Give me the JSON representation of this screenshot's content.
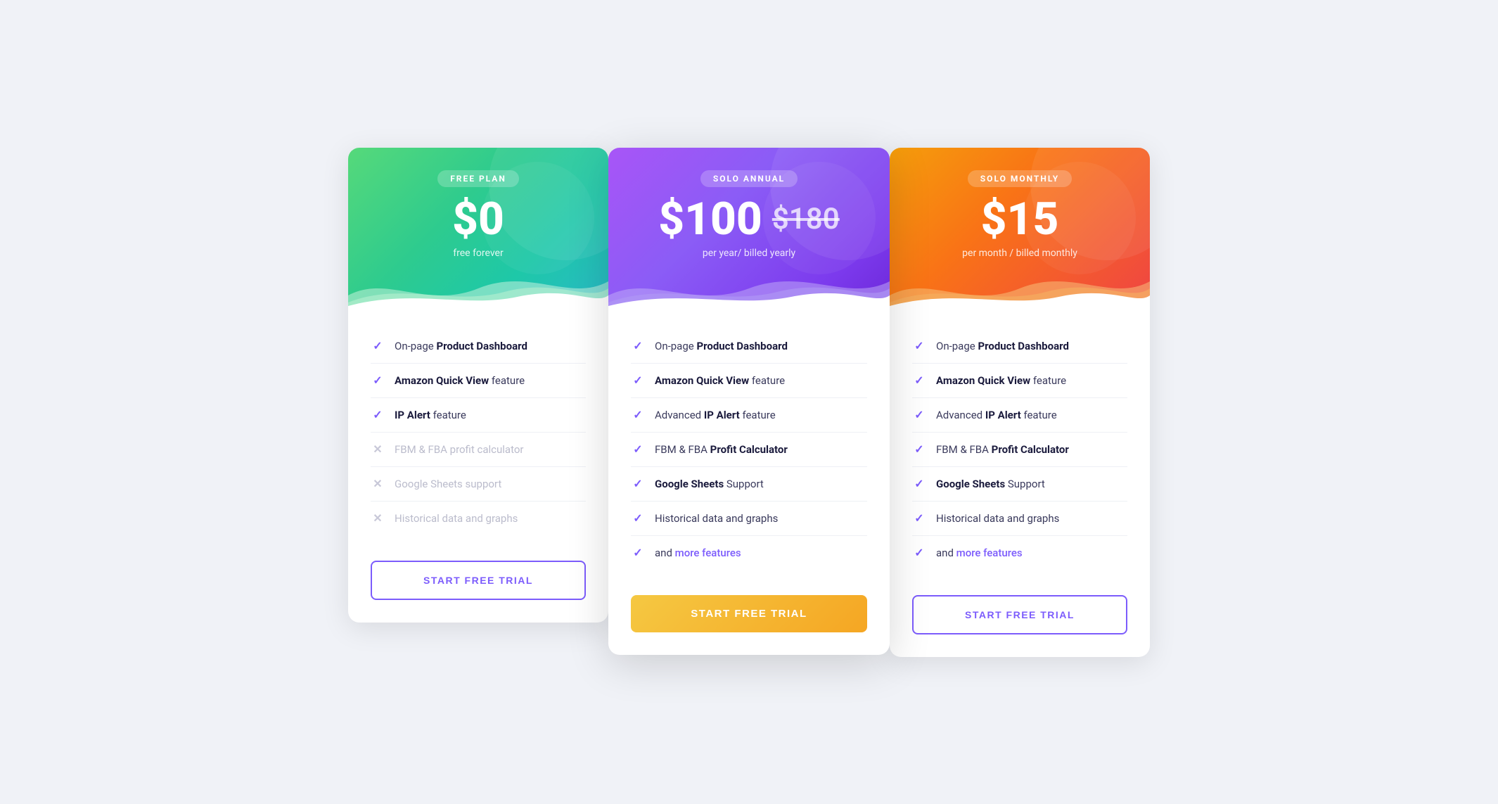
{
  "plans": [
    {
      "id": "free",
      "badge": "FREE PLAN",
      "price": "$0",
      "originalPrice": null,
      "sub": "free forever",
      "headerClass": "free",
      "featured": false,
      "btnClass": "btn-outline",
      "btnLabel": "START FREE TRIAL",
      "features": [
        {
          "enabled": true,
          "text": "On-page ",
          "bold": "Product Dashboard",
          "after": ""
        },
        {
          "enabled": true,
          "text": "",
          "bold": "Amazon Quick View",
          "after": " feature"
        },
        {
          "enabled": true,
          "text": "",
          "bold": "IP Alert",
          "after": " feature"
        },
        {
          "enabled": false,
          "text": "FBM & FBA profit calculator",
          "bold": "",
          "after": ""
        },
        {
          "enabled": false,
          "text": "Google Sheets support",
          "bold": "",
          "after": ""
        },
        {
          "enabled": false,
          "text": "Historical data and graphs",
          "bold": "",
          "after": ""
        }
      ]
    },
    {
      "id": "annual",
      "badge": "SOLO ANNUAL",
      "price": "$100",
      "originalPrice": "$180",
      "sub": "per year/ billed yearly",
      "headerClass": "annual",
      "featured": true,
      "btnClass": "btn-solid",
      "btnLabel": "START FREE TRIAL",
      "features": [
        {
          "enabled": true,
          "text": "On-page ",
          "bold": "Product Dashboard",
          "after": ""
        },
        {
          "enabled": true,
          "text": "",
          "bold": "Amazon Quick View",
          "after": " feature"
        },
        {
          "enabled": true,
          "text": "Advanced ",
          "bold": "IP Alert",
          "after": " feature"
        },
        {
          "enabled": true,
          "text": "FBM & FBA ",
          "bold": "Profit Calculator",
          "after": ""
        },
        {
          "enabled": true,
          "text": "",
          "bold": "Google Sheets",
          "after": " Support"
        },
        {
          "enabled": true,
          "text": "Historical data and graphs",
          "bold": "",
          "after": ""
        },
        {
          "enabled": true,
          "text": "and ",
          "bold": "",
          "after": "more features",
          "isMore": true
        }
      ]
    },
    {
      "id": "monthly",
      "badge": "SOLO MONTHLY",
      "price": "$15",
      "originalPrice": null,
      "sub": "per month / billed monthly",
      "headerClass": "monthly",
      "featured": false,
      "btnClass": "btn-outline",
      "btnLabel": "START FREE TRIAL",
      "features": [
        {
          "enabled": true,
          "text": "On-page ",
          "bold": "Product Dashboard",
          "after": ""
        },
        {
          "enabled": true,
          "text": "",
          "bold": "Amazon Quick View",
          "after": " feature"
        },
        {
          "enabled": true,
          "text": "Advanced ",
          "bold": "IP Alert",
          "after": " feature"
        },
        {
          "enabled": true,
          "text": "FBM & FBA ",
          "bold": "Profit Calculator",
          "after": ""
        },
        {
          "enabled": true,
          "text": "",
          "bold": "Google Sheets",
          "after": " Support"
        },
        {
          "enabled": true,
          "text": "Historical data and graphs",
          "bold": "",
          "after": ""
        },
        {
          "enabled": true,
          "text": "and ",
          "bold": "",
          "after": "more features",
          "isMore": true
        }
      ]
    }
  ]
}
